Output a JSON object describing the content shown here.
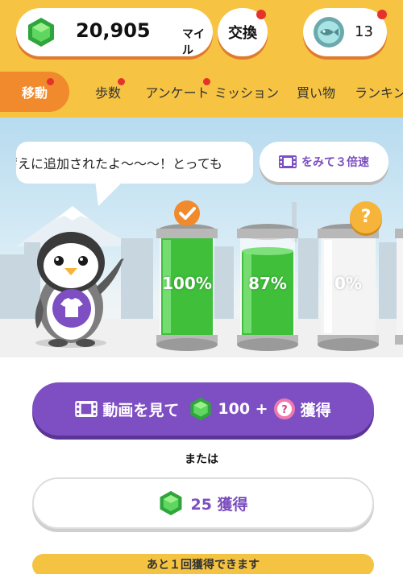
{
  "header": {
    "miles_value": "20,905",
    "miles_unit": "マイル",
    "exchange_label": "交換",
    "coin_count": "13"
  },
  "tabs": [
    {
      "label": "移動",
      "active": true,
      "badge": true
    },
    {
      "label": "歩数",
      "active": false,
      "badge": true
    },
    {
      "label": "アンケート",
      "active": false,
      "badge": true
    },
    {
      "label": "ミッション",
      "active": false,
      "badge": false
    },
    {
      "label": "買い物",
      "active": false,
      "badge": false
    },
    {
      "label": "ランキング",
      "active": false,
      "badge": false
    }
  ],
  "scene": {
    "speech_text": "蓄えに追加されたよ〜〜〜！とっても",
    "video_speed_label": "をみて３倍速",
    "tubes": [
      {
        "percent_label": "100%",
        "fill": 1.0,
        "badge": "check"
      },
      {
        "percent_label": "87%",
        "fill": 0.87,
        "badge": null
      },
      {
        "percent_label": "0%",
        "fill": 0.0,
        "badge": "question"
      }
    ],
    "question_mark": "?"
  },
  "actions": {
    "watch_prefix": "動画を見て",
    "watch_amount": "100 +",
    "watch_suffix": "獲得",
    "or_label": "または",
    "get_label": "25 獲得",
    "remaining_label": "あと１回獲得できます"
  },
  "colors": {
    "header_bg": "#f6c342",
    "active_tab": "#f08a2c",
    "accent_purple": "#7d4fc3",
    "badge_red": "#e5322d",
    "gem_green": "#3fbf4a"
  },
  "icons": {
    "gem": "green-gem-icon",
    "coin": "fish-coin-icon",
    "film": "film-icon",
    "check": "check-icon",
    "question": "question-icon",
    "shirt": "shirt-icon"
  }
}
